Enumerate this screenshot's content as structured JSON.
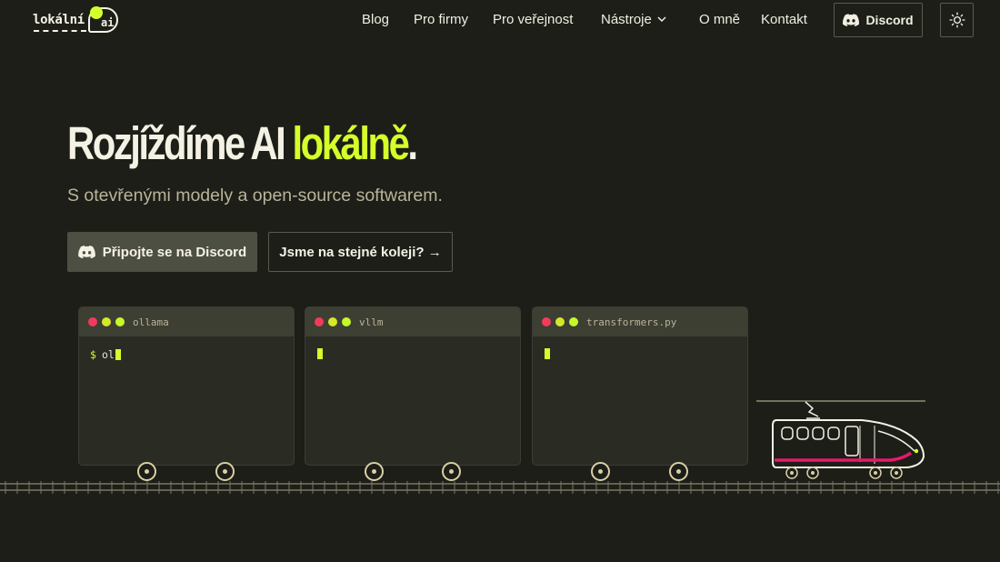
{
  "header": {
    "logo_text": "lokální",
    "logo_badge": "ai",
    "nav": {
      "blog": "Blog",
      "pro_firmy": "Pro firmy",
      "pro_verejnost": "Pro veřejnost",
      "nastroje": "Nástroje",
      "o_mne": "O mně",
      "kontakt": "Kontakt"
    },
    "discord_label": "Discord",
    "theme_icon": "sun-icon"
  },
  "hero": {
    "title_main": "Rozjíždíme AI ",
    "title_accent": "lokálně",
    "title_end": ".",
    "subtitle": "S otevřenými modely a open-source softwarem.",
    "primary_button": "Připojte se na Discord",
    "secondary_button": "Jsme na stejné koleji? →"
  },
  "terminals": [
    {
      "title": "ollama",
      "prompt": "$",
      "text": "ol"
    },
    {
      "title": "vllm",
      "prompt": "",
      "text": ""
    },
    {
      "title": "transformers.py",
      "prompt": "",
      "text": ""
    }
  ],
  "colors": {
    "background": "#1d1e18",
    "accent": "#d5ff2a",
    "text": "#f4f2e4",
    "muted": "#b9b49a",
    "train_stripe": "#e6186e"
  }
}
